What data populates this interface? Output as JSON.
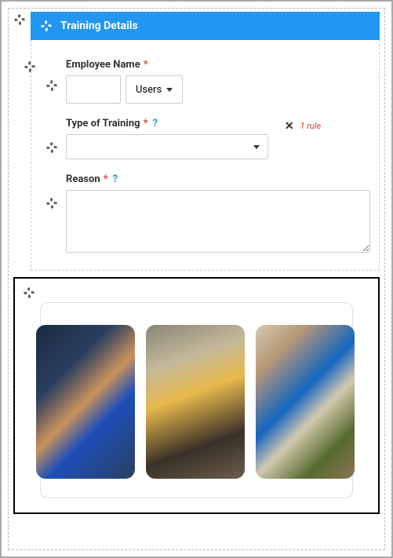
{
  "section": {
    "title": "Training Details"
  },
  "fields": {
    "employee": {
      "label": "Employee Name",
      "required": "*",
      "users_btn": "Users"
    },
    "training": {
      "label": "Type of Training",
      "required": "*",
      "rule_text": "1 rule"
    },
    "reason": {
      "label": "Reason",
      "required": "*"
    }
  }
}
